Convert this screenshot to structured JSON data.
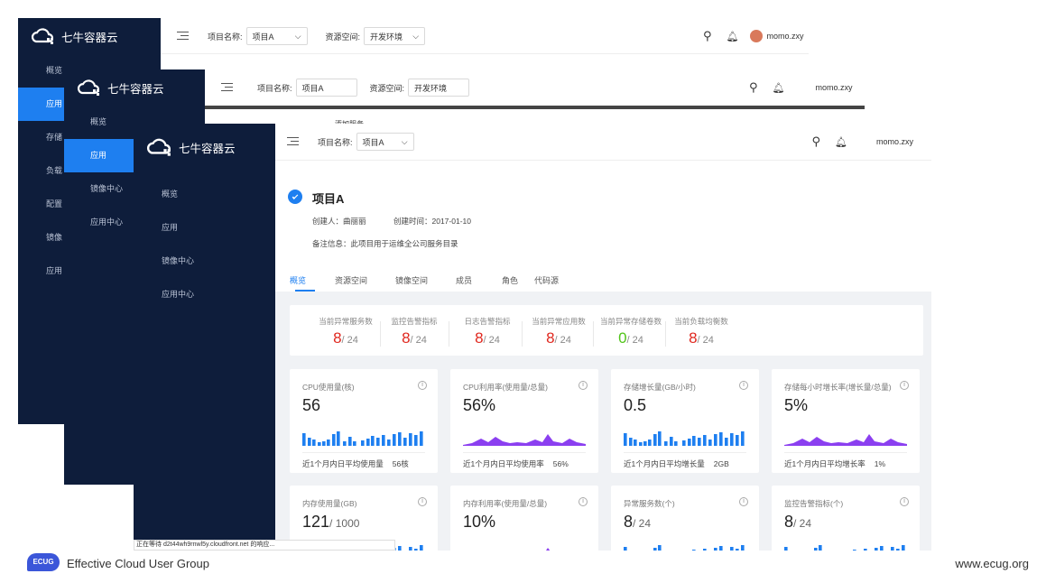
{
  "app_name": "七牛容器云",
  "project_label": "项目名称:",
  "project_value": "项目A",
  "space_label": "资源空间:",
  "space_value": "开发环境",
  "user": "momo.zxy",
  "nav_w1": [
    "概览",
    "应用",
    "存储",
    "负载",
    "配置",
    "镜像",
    "应用"
  ],
  "nav_w2": [
    "概览",
    "应用",
    "镜像中心",
    "应用中心"
  ],
  "nav_w3": [
    "概览",
    "应用",
    "镜像中心",
    "应用中心"
  ],
  "partial_text_w2": "添加服务",
  "project": {
    "title": "项目A",
    "creator": "创建人：曲丽丽",
    "created": "创建时间：2017-01-10",
    "note": "备注信息：此项目用于运维全公司服务目录"
  },
  "tabs": [
    "概览",
    "资源空间",
    "镜像空间",
    "成员",
    "角色",
    "代码源"
  ],
  "stats": [
    {
      "title": "当前异常服务数",
      "value": "8",
      "total": "/ 24",
      "color": "#e0281f"
    },
    {
      "title": "监控告警指标",
      "value": "8",
      "total": "/ 24",
      "color": "#e0281f"
    },
    {
      "title": "日志告警指标",
      "value": "8",
      "total": "/ 24",
      "color": "#e0281f"
    },
    {
      "title": "当前异常应用数",
      "value": "8",
      "total": "/ 24",
      "color": "#e0281f"
    },
    {
      "title": "当前异常存储卷数",
      "value": "0",
      "total": "/ 24",
      "color": "#52c41a"
    },
    {
      "title": "当前负载均衡数",
      "value": "8",
      "total": "/ 24",
      "color": "#e0281f"
    }
  ],
  "cards_row1": [
    {
      "title": "CPU使用量(核)",
      "value": "56",
      "unit": "",
      "chart": "bar",
      "footer": "近1个月内日平均使用量",
      "footer_val": "56核"
    },
    {
      "title": "CPU利用率(使用量/总量)",
      "value": "56%",
      "unit": "",
      "chart": "area",
      "footer": "近1个月内日平均使用率",
      "footer_val": "56%"
    },
    {
      "title": "存储增长量(GB/小时)",
      "value": "0.5",
      "unit": "",
      "chart": "bar",
      "footer": "近1个月内日平均增长量",
      "footer_val": "2GB"
    },
    {
      "title": "存储每小时增长率(增长量/总量)",
      "value": "5%",
      "unit": "",
      "chart": "area",
      "footer": "近1个月内日平均增长率",
      "footer_val": "1%"
    }
  ],
  "cards_row2": [
    {
      "title": "内存使用量(GB)",
      "value": "121",
      "unit": "/ 1000",
      "chart": "bar"
    },
    {
      "title": "内存利用率(使用量/总量)",
      "value": "10%",
      "unit": "",
      "chart": "area"
    },
    {
      "title": "异常服务数(个)",
      "value": "8",
      "unit": "/ 24",
      "chart": "bar"
    },
    {
      "title": "监控告警指标(个)",
      "value": "8",
      "unit": "/ 24",
      "chart": "bar"
    }
  ],
  "status_bar": "正在等待 d2t44wh9rnwl5y.cloudfront.net 的响应...",
  "footer_brand": "Effective Cloud User Group",
  "footer_logo": "ECUG",
  "footer_url": "www.ecug.org",
  "colors": {
    "sidebar": "#0e1d3b",
    "accent": "#1e7ff0",
    "red": "#e0281f",
    "green": "#52c41a",
    "purple": "#8b3ff0"
  }
}
